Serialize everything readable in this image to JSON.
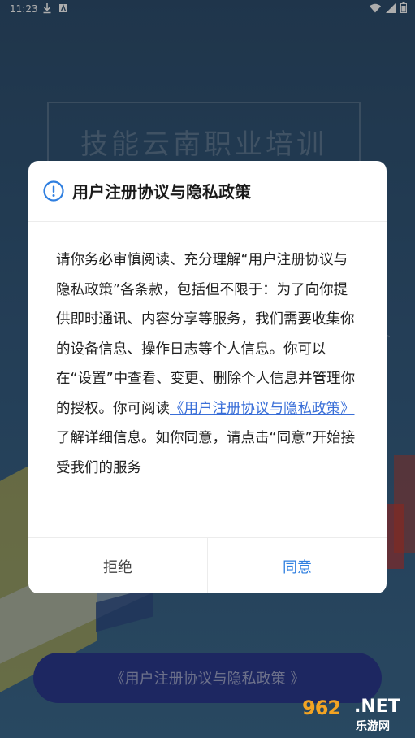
{
  "status_bar": {
    "time": "11:23",
    "left_icons": [
      "download-icon",
      "a-app-icon"
    ],
    "right_icons": [
      "wifi-icon",
      "signal-icon",
      "battery-icon"
    ]
  },
  "background": {
    "title": "技能云南职业培训",
    "bottom_button_label": "《用户注册协议与隐私政策 》"
  },
  "dialog": {
    "icon": "info-icon",
    "title": "用户注册协议与隐私政策",
    "body_before_link": "请你务必审慎阅读、充分理解“用户注册协议与隐私政策”各条款，包括但不限于：为了向你提供即时通讯、内容分享等服务，我们需要收集你的设备信息、操作日志等个人信息。你可以在“设置”中查看、变更、删除个人信息并管理你的授权。你可阅读",
    "body_link": "《用户注册协议与隐私政策》",
    "body_after_link": "了解详细信息。如你同意，请点击“同意”开始接受我们的服务",
    "reject_label": "拒绝",
    "agree_label": "同意"
  },
  "watermark": {
    "number": "962",
    "suffix": ".NET",
    "site_name": "乐游网"
  },
  "colors": {
    "accent": "#2f7fe0",
    "link": "#3a6fd8",
    "bottom_button": "#2b3a8f"
  }
}
